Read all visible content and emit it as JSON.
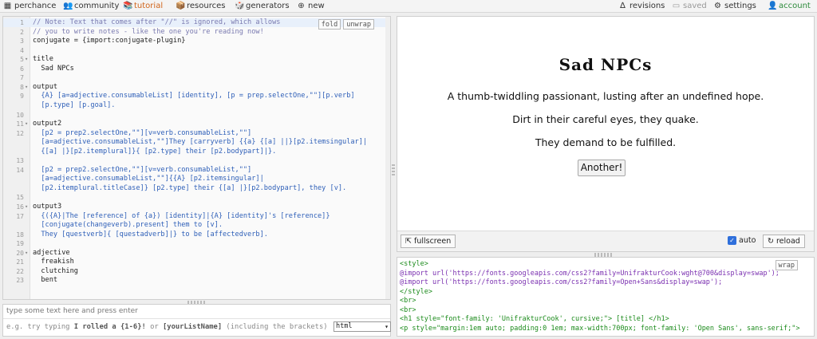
{
  "menu": {
    "perchance": "perchance",
    "community": "community",
    "tutorial": "tutorial",
    "resources": "resources",
    "generators": "generators",
    "new": "new",
    "revisions": "revisions",
    "saved": "saved",
    "settings": "settings",
    "account": "account"
  },
  "editor": {
    "fold_label": "fold",
    "unwrap_label": "unwrap",
    "lines": [
      {
        "n": "1",
        "fold": "",
        "text": "// Note: Text that comes after \"//\" is ignored, which allows",
        "cls": "c-comment",
        "hl": true
      },
      {
        "n": "2",
        "fold": "",
        "text": "// you to write notes - like the one you're reading now!",
        "cls": "c-comment"
      },
      {
        "n": "3",
        "fold": "",
        "text": "conjugate = {import:conjugate-plugin}",
        "cls": "c-plain"
      },
      {
        "n": "4",
        "fold": "",
        "text": "",
        "cls": "c-plain"
      },
      {
        "n": "5",
        "fold": "▾",
        "text": "title",
        "cls": "c-plain"
      },
      {
        "n": "6",
        "fold": "",
        "text": "  Sad NPCs",
        "cls": "c-plain"
      },
      {
        "n": "7",
        "fold": "",
        "text": "",
        "cls": "c-plain"
      },
      {
        "n": "8",
        "fold": "▾",
        "text": "output",
        "cls": "c-plain"
      },
      {
        "n": "9",
        "fold": "",
        "text": "  {A} [a=adjective.consumableList] [identity], [p = prep.selectOne,\"\"][p.verb]",
        "cls": "c-br"
      },
      {
        "n": "",
        "fold": "",
        "text": "  [p.type] [p.goal].",
        "cls": "c-br"
      },
      {
        "n": "10",
        "fold": "",
        "text": "",
        "cls": "c-plain"
      },
      {
        "n": "11",
        "fold": "▾",
        "text": "output2",
        "cls": "c-plain"
      },
      {
        "n": "12",
        "fold": "",
        "text": "  [p2 = prep2.selectOne,\"\"][v=verb.consumableList,\"\"]",
        "cls": "c-br"
      },
      {
        "n": "",
        "fold": "",
        "text": "  [a=adjective.consumableList,\"\"]They [carryverb] {{a} {[a] ||}[p2.itemsingular]|",
        "cls": "c-br"
      },
      {
        "n": "",
        "fold": "",
        "text": "  {[a] |}[p2.itemplural]}{ [p2.type] their [p2.bodypart]|}.",
        "cls": "c-br"
      },
      {
        "n": "13",
        "fold": "",
        "text": "",
        "cls": "c-plain"
      },
      {
        "n": "14",
        "fold": "",
        "text": "  [p2 = prep2.selectOne,\"\"][v=verb.consumableList,\"\"]",
        "cls": "c-br"
      },
      {
        "n": "",
        "fold": "",
        "text": "  [a=adjective.consumableList,\"\"]{{A} [p2.itemsingular]|",
        "cls": "c-br"
      },
      {
        "n": "",
        "fold": "",
        "text": "  [p2.itemplural.titleCase]} [p2.type] their {[a] |}[p2.bodypart], they [v].",
        "cls": "c-br"
      },
      {
        "n": "15",
        "fold": "",
        "text": "",
        "cls": "c-plain"
      },
      {
        "n": "16",
        "fold": "▾",
        "text": "output3",
        "cls": "c-plain"
      },
      {
        "n": "17",
        "fold": "",
        "text": "  {({A}|The [reference] of {a}) [identity]|{A} [identity]'s [reference]}",
        "cls": "c-br"
      },
      {
        "n": "",
        "fold": "",
        "text": "  [conjugate(changeverb).present] them to [v].",
        "cls": "c-br"
      },
      {
        "n": "18",
        "fold": "",
        "text": "  They [questverb]{ [questadverb]|} to be [affectedverb].",
        "cls": "c-br"
      },
      {
        "n": "19",
        "fold": "",
        "text": "",
        "cls": "c-plain"
      },
      {
        "n": "20",
        "fold": "▾",
        "text": "adjective",
        "cls": "c-plain"
      },
      {
        "n": "21",
        "fold": "",
        "text": "  freakish",
        "cls": "c-plain"
      },
      {
        "n": "22",
        "fold": "",
        "text": "  clutching",
        "cls": "c-plain"
      },
      {
        "n": "23",
        "fold": "",
        "text": "  bent",
        "cls": "c-plain"
      }
    ]
  },
  "input_panel": {
    "line1": "type some text here and press enter",
    "line2_prefix": "e.g. try typing ",
    "line2_bold1": "I rolled a {1-6}!",
    "line2_mid": " or ",
    "line2_bold2": "[yourListName]",
    "line2_suffix": " (including the brackets)",
    "mode_select": "html"
  },
  "output": {
    "title": "Sad NPCs",
    "lines": [
      "A thumb-twiddling passionant, lusting after an undefined hope.",
      "Dirt in their careful eyes, they quake.",
      "They demand to be fulfilled."
    ],
    "another_label": "Another!",
    "fullscreen_label": "fullscreen",
    "auto_label": "auto",
    "reload_label": "reload"
  },
  "source": {
    "wrap_label": "wrap",
    "lines": [
      "<style>",
      "@import url('https://fonts.googleapis.com/css2?family=UnifrakturCook:wght@700&display=swap');",
      "@import url('https://fonts.googleapis.com/css2?family=Open+Sans&display=swap');",
      "</style>",
      "<br>",
      "<br>",
      "<h1 style=\"font-family: 'UnifrakturCook', cursive;\"> [title] </h1>",
      "<p style=\"margin:1em auto; padding:0 1em; max-width:700px; font-family: 'Open Sans', sans-serif;\">"
    ]
  },
  "colors": {
    "tutorial": "#d0641a",
    "account": "#2e8b3c",
    "checkbox": "#2f6fdb"
  }
}
